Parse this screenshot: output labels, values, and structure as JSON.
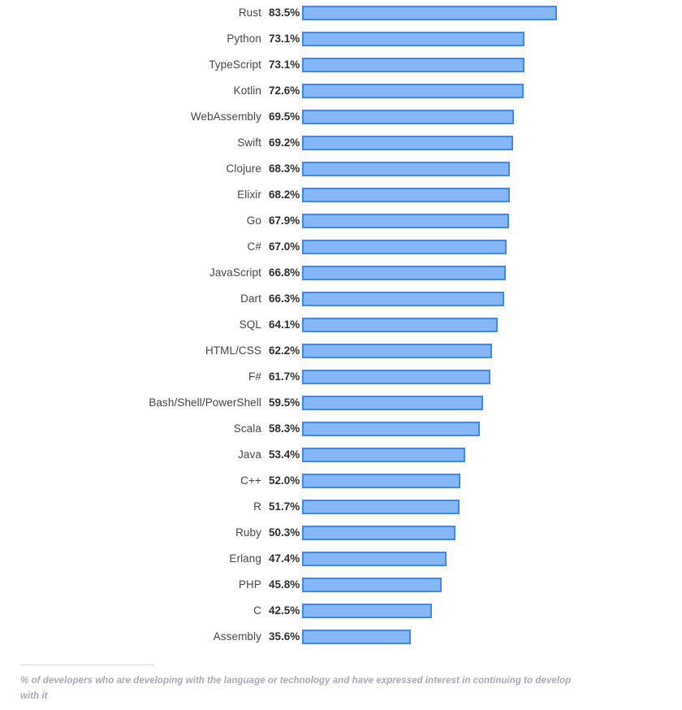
{
  "chart_data": {
    "type": "bar",
    "orientation": "horizontal",
    "title": "",
    "subtitle": "",
    "xlabel": "",
    "ylabel": "",
    "grid": false,
    "legend": null,
    "xlim": [
      0,
      100
    ],
    "value_suffix": "%",
    "bar_fill_color": "#85b7f7",
    "bar_border_color": "#4285f4",
    "categories": [
      "Rust",
      "Python",
      "TypeScript",
      "Kotlin",
      "WebAssembly",
      "Swift",
      "Clojure",
      "Elixir",
      "Go",
      "C#",
      "JavaScript",
      "Dart",
      "SQL",
      "HTML/CSS",
      "F#",
      "Bash/Shell/PowerShell",
      "Scala",
      "Java",
      "C++",
      "R",
      "Ruby",
      "Erlang",
      "PHP",
      "C",
      "Assembly"
    ],
    "values": [
      83.5,
      73.1,
      73.1,
      72.6,
      69.5,
      69.2,
      68.3,
      68.2,
      67.9,
      67.0,
      66.8,
      66.3,
      64.1,
      62.2,
      61.7,
      59.5,
      58.3,
      53.4,
      52.0,
      51.7,
      50.3,
      47.4,
      45.8,
      42.5,
      35.6
    ],
    "value_labels": [
      "83.5%",
      "73.1%",
      "73.1%",
      "72.6%",
      "69.5%",
      "69.2%",
      "68.3%",
      "68.2%",
      "67.9%",
      "67.0%",
      "66.8%",
      "66.3%",
      "64.1%",
      "62.2%",
      "61.7%",
      "59.5%",
      "58.3%",
      "53.4%",
      "52.0%",
      "51.7%",
      "50.3%",
      "47.4%",
      "45.8%",
      "42.5%",
      "35.6%"
    ],
    "annotations": [
      "% of developers who are developing with the language or technology and have expressed interest in continuing to develop with it"
    ]
  },
  "footnote": {
    "text": "% of developers who are developing with the language or technology and have expressed interest in continuing to develop with it"
  }
}
